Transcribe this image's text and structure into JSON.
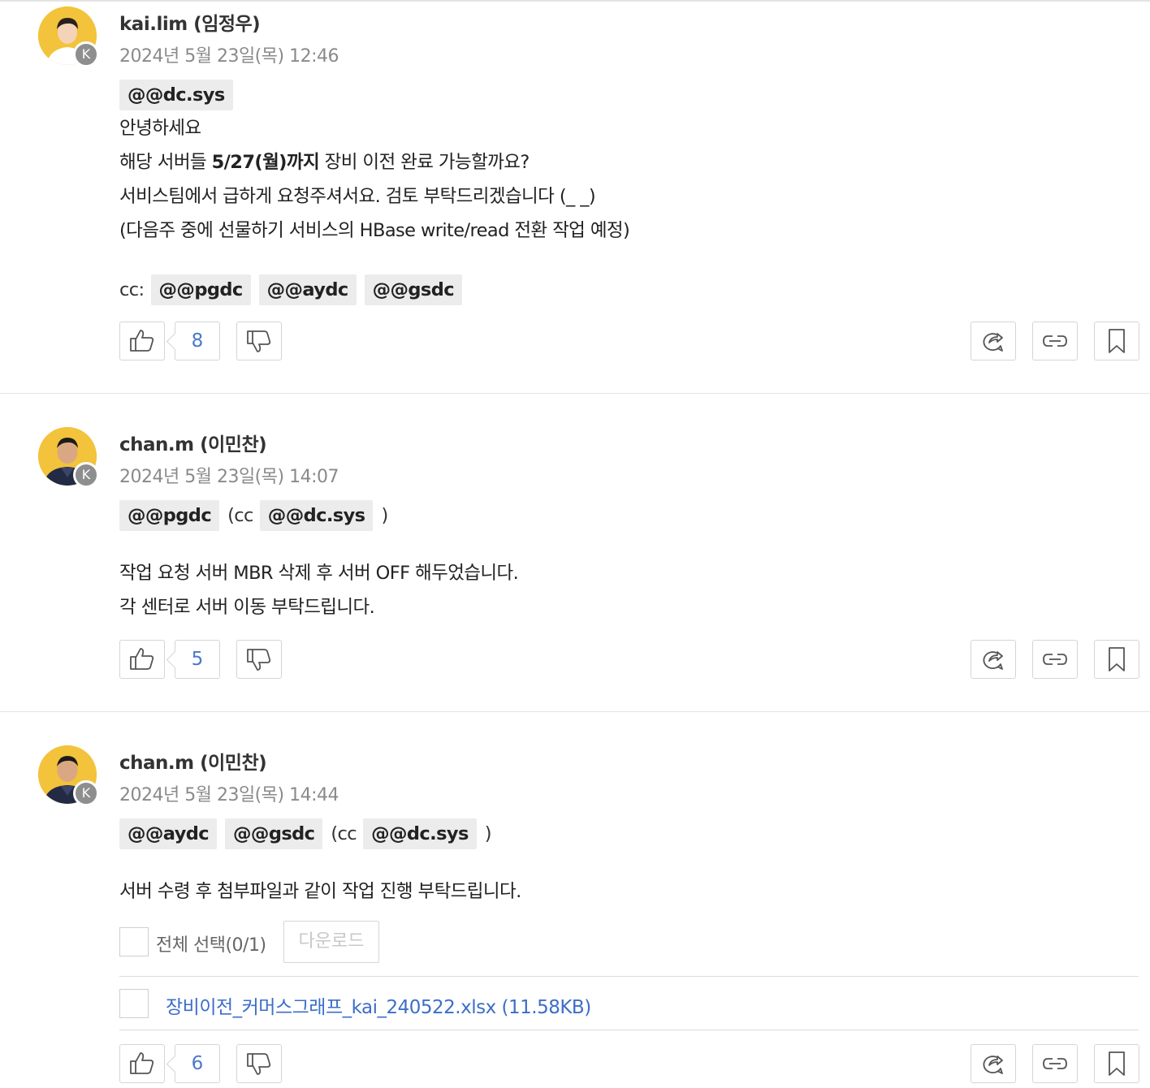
{
  "messages": [
    {
      "author": "kai.lim (임정우)",
      "badge": "K",
      "time": "2024년 5월 23일(목) 12:46",
      "mention_line": [
        "@@dc.sys"
      ],
      "lines": [
        "안녕하세요",
        "해당 서버들 ",
        "5/27(월)까지",
        " 장비 이전 완료 가능할까요?",
        "서비스팀에서 급하게 요청주셔서요. 검토 부탁드리겠습니다 (_ _)",
        "(다음주 중에 선물하기 서비스의 HBase write/read 전환 작업 예정)"
      ],
      "cc_label": "cc:",
      "cc_mentions": [
        "@@pgdc",
        "@@aydc",
        "@@gsdc"
      ],
      "likes": "8"
    },
    {
      "author": "chan.m (이민찬)",
      "badge": "K",
      "time": "2024년 5월 23일(목) 14:07",
      "mention_line": [
        "@@pgdc"
      ],
      "cc_open": "(cc",
      "cc_mention": "@@dc.sys",
      "cc_close": ")",
      "lines": [
        "작업 요청 서버 MBR 삭제 후 서버 OFF 해두었습니다.",
        "각 센터로 서버 이동 부탁드립니다."
      ],
      "likes": "5"
    },
    {
      "author": "chan.m (이민찬)",
      "badge": "K",
      "time": "2024년 5월 23일(목) 14:44",
      "mention_line": [
        "@@aydc",
        "@@gsdc"
      ],
      "cc_open": "(cc",
      "cc_mention": "@@dc.sys",
      "cc_close": ")",
      "lines": [
        "서버 수령 후 첨부파일과 같이 작업 진행 부탁드립니다."
      ],
      "select_all_label": "전체 선택(0/1)",
      "download_label": "다운로드",
      "file": "장비이전_커머스그래프_kai_240522.xlsx (11.58KB)",
      "likes": "6"
    }
  ],
  "icons": {
    "like": "thumbs-up-icon",
    "dislike": "thumbs-down-icon",
    "share": "share-icon",
    "link": "link-icon",
    "bookmark": "bookmark-icon"
  },
  "colors": {
    "count": "#4a79c8",
    "avatar_bg": "#f2c33b",
    "mention_bg": "#ececec",
    "file_link": "#3d6ec8"
  }
}
